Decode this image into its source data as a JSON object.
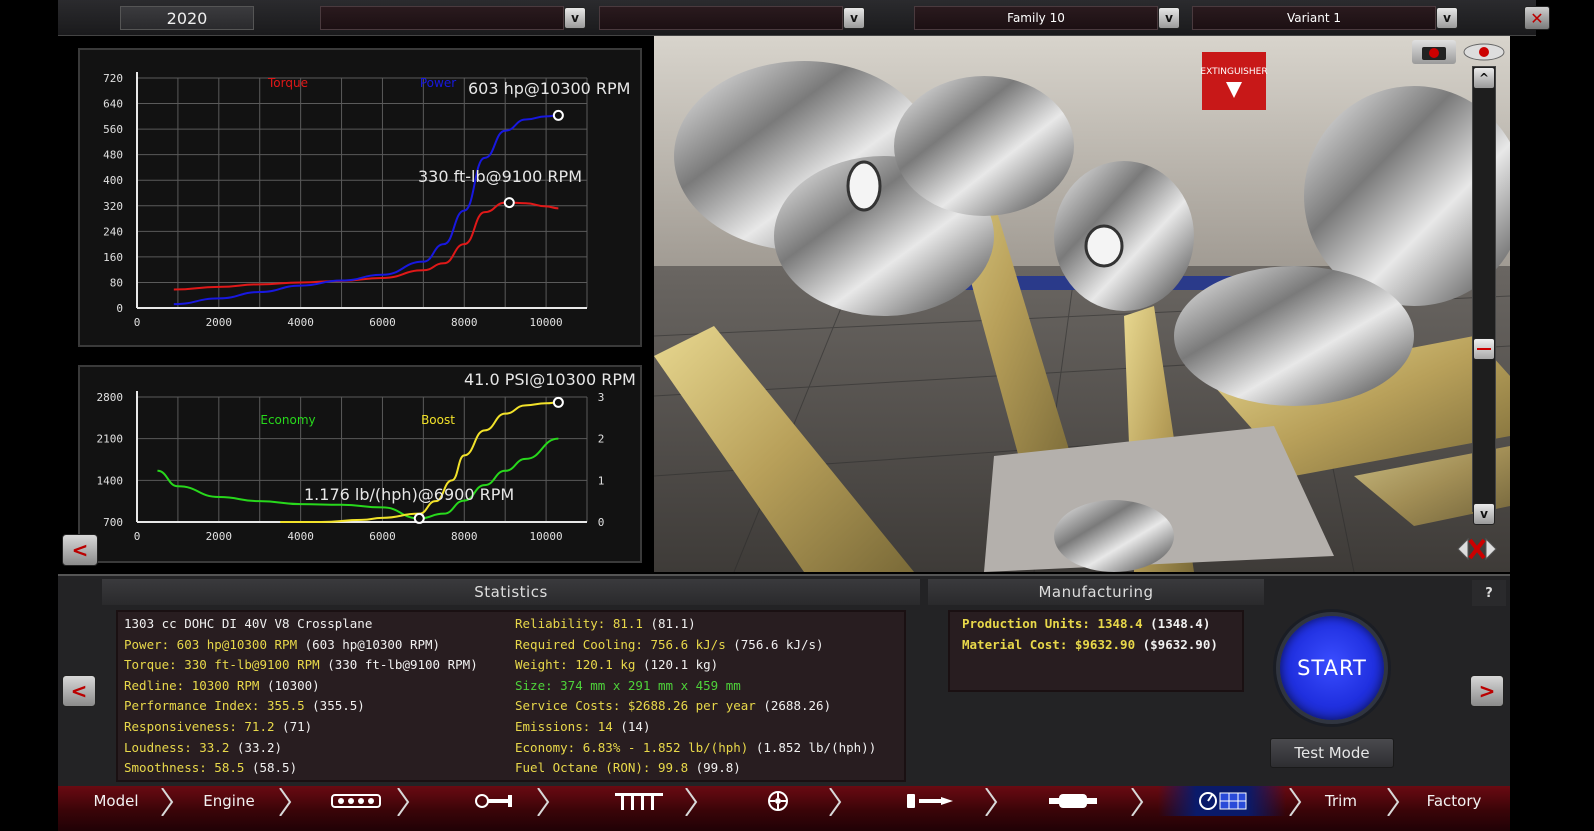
{
  "topbar": {
    "year": "2020",
    "family": "Family 10",
    "variant": "Variant 1",
    "dropdown_glyph": "v",
    "close_glyph": "✕"
  },
  "power_chart": {
    "power_annotation": "603 hp@10300 RPM",
    "torque_annotation": "330 ft-lb@9100 RPM"
  },
  "econ_chart": {
    "boost_annotation": "41.0 PSI@10300 RPM",
    "economy_annotation": "1.176 lb/(hph)@6900 RPM"
  },
  "chart_data": [
    {
      "type": "line",
      "title": "",
      "xlabel": "",
      "ylabel": "",
      "xlim": [
        0,
        11000
      ],
      "ylim": [
        0,
        720
      ],
      "xticks": [
        0,
        2000,
        4000,
        6000,
        8000,
        10000
      ],
      "yticks": [
        0,
        80,
        160,
        240,
        320,
        400,
        480,
        560,
        640,
        720
      ],
      "grid": true,
      "legend": "top-center",
      "series": [
        {
          "name": "Torque",
          "color": "#e01818",
          "x": [
            900,
            2000,
            3000,
            4000,
            5000,
            6000,
            7000,
            7500,
            8000,
            8500,
            9000,
            9100,
            9500,
            10000,
            10300
          ],
          "y": [
            58,
            66,
            74,
            80,
            85,
            94,
            118,
            140,
            200,
            300,
            330,
            330,
            328,
            318,
            312
          ]
        },
        {
          "name": "Power",
          "color": "#1818e0",
          "x": [
            900,
            2000,
            3000,
            4000,
            5000,
            6000,
            7000,
            7500,
            8000,
            8500,
            9000,
            9500,
            10000,
            10300
          ],
          "y": [
            12,
            30,
            50,
            70,
            86,
            104,
            145,
            200,
            305,
            470,
            555,
            590,
            600,
            603
          ]
        }
      ],
      "markers": [
        {
          "series": "Power",
          "x": 10300,
          "y": 603
        },
        {
          "series": "Torque",
          "x": 9100,
          "y": 330
        }
      ]
    },
    {
      "type": "line",
      "title": "",
      "xlabel": "",
      "ylabel": "",
      "xlim": [
        0,
        11000
      ],
      "ylim": [
        700,
        2800
      ],
      "y2lim": [
        0,
        3
      ],
      "xticks": [
        0,
        2000,
        4000,
        6000,
        8000,
        10000
      ],
      "yticks": [
        700,
        1400,
        2100,
        2800
      ],
      "y2ticks": [
        0,
        1,
        2,
        3
      ],
      "grid": true,
      "legend": "top-center",
      "series": [
        {
          "name": "Economy",
          "color": "#28d81c",
          "axis": "left",
          "x": [
            500,
            1000,
            2000,
            3000,
            4000,
            5000,
            6000,
            6900,
            7500,
            8000,
            8500,
            9000,
            9500,
            10300
          ],
          "y": [
            1560,
            1300,
            1120,
            1050,
            1000,
            990,
            945,
            760,
            840,
            1060,
            1320,
            1560,
            1760,
            2100
          ]
        },
        {
          "name": "Boost",
          "color": "#f2e22a",
          "axis": "right",
          "x": [
            3500,
            4500,
            5500,
            6000,
            6900,
            7300,
            7700,
            8000,
            8500,
            9000,
            9500,
            10000,
            10300
          ],
          "y": [
            0,
            0.0,
            0.05,
            0.1,
            0.2,
            0.5,
            1.0,
            1.6,
            2.2,
            2.6,
            2.8,
            2.85,
            2.87
          ]
        }
      ],
      "markers": [
        {
          "series": "Boost",
          "x": 10300,
          "y": 2.87
        },
        {
          "series": "Economy",
          "x": 6900,
          "y": 760
        }
      ]
    }
  ],
  "viewport": {
    "camera_icon": "camera-icon",
    "eye_icon": "eye-icon",
    "scroll_up": "^",
    "scroll_down": "v",
    "sign_text": "EXTINGUISHER"
  },
  "statistics": {
    "header": "Statistics",
    "left": [
      {
        "label": "1303 cc DOHC DI 40V V8 Crossplane",
        "paren": "",
        "label_color": "white"
      },
      {
        "label": "Power: 603 hp@10300 RPM",
        "paren": "(603 hp@10300 RPM)",
        "label_color": "yellow"
      },
      {
        "label": "Torque: 330 ft-lb@9100 RPM",
        "paren": "(330 ft-lb@9100 RPM)",
        "label_color": "yellow"
      },
      {
        "label": "Redline: 10300 RPM",
        "paren": "(10300)",
        "label_color": "yellow"
      },
      {
        "label": "Performance Index: 355.5",
        "paren": "(355.5)",
        "label_color": "yellow"
      },
      {
        "label": "Responsiveness: 71.2",
        "paren": "(71)",
        "label_color": "yellow"
      },
      {
        "label": "Loudness: 33.2",
        "paren": "(33.2)",
        "label_color": "yellow"
      },
      {
        "label": "Smoothness: 58.5",
        "paren": "(58.5)",
        "label_color": "yellow"
      }
    ],
    "right": [
      {
        "label": "Reliability: 81.1",
        "paren": "(81.1)",
        "label_color": "yellow"
      },
      {
        "label": "Required Cooling: 756.6 kJ/s",
        "paren": "(756.6 kJ/s)",
        "label_color": "yellow"
      },
      {
        "label": "Weight: 120.1 kg",
        "paren": "(120.1 kg)",
        "label_color": "yellow"
      },
      {
        "label": "Size: 374 mm x 291 mm x 459 mm",
        "paren": "",
        "label_color": "green"
      },
      {
        "label": "Service Costs: $2688.26 per year",
        "paren": "(2688.26)",
        "label_color": "yellow"
      },
      {
        "label": "Emissions: 14",
        "paren": "(14)",
        "label_color": "yellow"
      },
      {
        "label": "Economy: 6.83% - 1.852 lb/(hph)",
        "paren": "(1.852 lb/(hph))",
        "label_color": "yellow"
      },
      {
        "label": "Fuel Octane (RON): 99.8",
        "paren": "(99.8)",
        "label_color": "yellow"
      }
    ]
  },
  "manufacturing": {
    "header": "Manufacturing",
    "rows": [
      {
        "label": "Production Units: 1348.4",
        "paren": "(1348.4)"
      },
      {
        "label": "Material Cost: $9632.90",
        "paren": "($9632.90)"
      }
    ]
  },
  "actions": {
    "start": "START",
    "test_mode": "Test Mode",
    "help": "?",
    "prev": "<",
    "next": ">"
  },
  "nav": {
    "items": [
      {
        "label": "Model",
        "icon": ""
      },
      {
        "label": "Engine",
        "icon": ""
      },
      {
        "label": "",
        "icon": "engine-block-icon"
      },
      {
        "label": "",
        "icon": "crankshaft-icon"
      },
      {
        "label": "",
        "icon": "valvetrain-icon"
      },
      {
        "label": "",
        "icon": "turbo-icon"
      },
      {
        "label": "",
        "icon": "fuel-injection-icon"
      },
      {
        "label": "",
        "icon": "exhaust-icon"
      },
      {
        "label": "",
        "icon": "gauge-icon"
      },
      {
        "label": "Trim",
        "icon": ""
      },
      {
        "label": "Factory",
        "icon": ""
      }
    ],
    "active_index": 8,
    "colors": {
      "bar": "#4a060c",
      "active": "#0a1a6a"
    }
  }
}
